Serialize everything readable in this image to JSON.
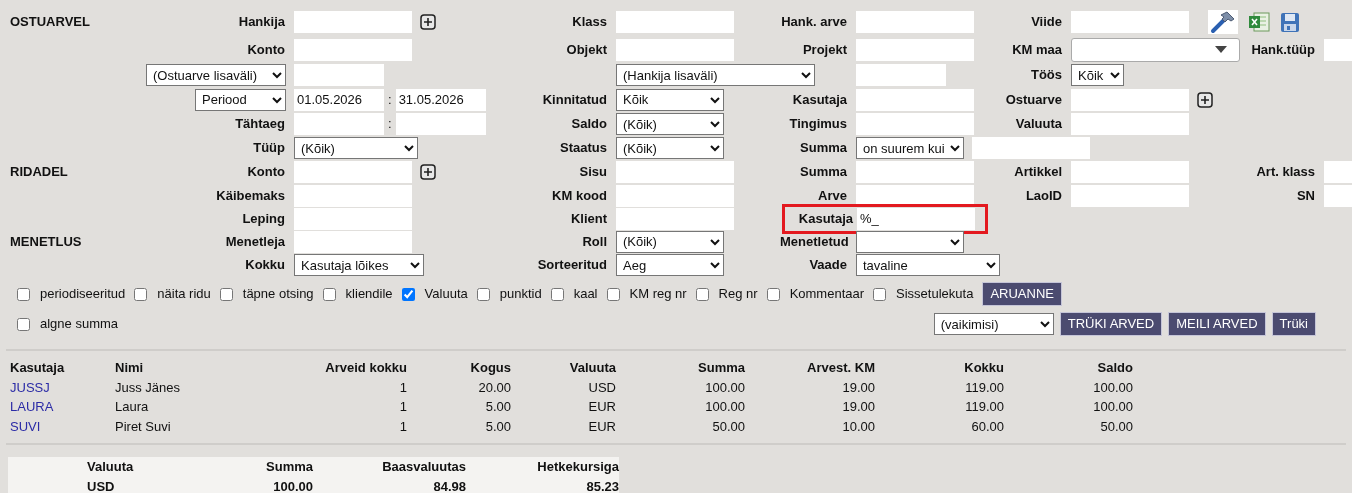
{
  "filter_rows": [
    [
      {
        "kind": "section",
        "text": "OSTUARVEL"
      },
      {
        "kind": "input",
        "label": "Hankija",
        "add_button": true
      },
      {
        "kind": "input",
        "label": "Klass"
      },
      {
        "kind": "input",
        "label": "Hank. arve"
      },
      {
        "kind": "input",
        "label": "Viide"
      }
    ],
    [
      {
        "kind": "input",
        "label": "Konto"
      },
      {
        "kind": "input",
        "label": "Objekt"
      },
      {
        "kind": "input",
        "label": "Projekt"
      },
      {
        "kind": "combo",
        "label": "KM maa"
      },
      {
        "kind": "input",
        "label": "Hank.tüüp"
      }
    ],
    [
      {
        "kind": "input",
        "label_select": "(Ostuarve lisaväli)"
      },
      {
        "kind": "select",
        "value": "(Hankija lisaväli)"
      },
      {
        "kind": "input"
      },
      {
        "kind": "select",
        "label": "Töös",
        "value": "Kõik"
      }
    ],
    [
      {
        "kind": "range",
        "label_select": "Periood",
        "from": "01.05.2026",
        "separator": ":",
        "to": "31.05.2026"
      },
      {
        "kind": "select",
        "label": "Kinnitatud",
        "value": "Kõik"
      },
      {
        "kind": "input",
        "label": "Kasutaja"
      },
      {
        "kind": "input",
        "label": "Ostuarve",
        "add_button": true
      }
    ],
    [
      {
        "kind": "range",
        "label": "Tähtaeg",
        "separator": ":"
      },
      {
        "kind": "select",
        "label": "Saldo",
        "value": "(Kõik)"
      },
      {
        "kind": "input",
        "label": "Tingimus"
      },
      {
        "kind": "input",
        "label": "Valuuta"
      }
    ],
    [
      {
        "kind": "select",
        "label": "Tüüp",
        "value": "(Kõik)"
      },
      {
        "kind": "select",
        "label": "Staatus",
        "value": "(Kõik)"
      },
      {
        "kind": "select-input",
        "label": "Summa",
        "value": "on suurem kui"
      }
    ],
    [
      {
        "kind": "section",
        "text": "RIDADEL"
      },
      {
        "kind": "input",
        "label": "Konto",
        "add_button": true
      },
      {
        "kind": "input",
        "label": "Sisu"
      },
      {
        "kind": "input",
        "label": "Summa"
      },
      {
        "kind": "input",
        "label": "Artikkel"
      },
      {
        "kind": "input",
        "label": "Art. klass"
      }
    ],
    [
      {
        "kind": "input",
        "label": "Käibemaks"
      },
      {
        "kind": "input",
        "label": "KM kood"
      },
      {
        "kind": "input",
        "label": "Arve"
      },
      {
        "kind": "input",
        "label": "LaoID"
      },
      {
        "kind": "input",
        "label": "SN"
      }
    ],
    [
      {
        "kind": "input",
        "label": "Leping"
      },
      {
        "kind": "input",
        "label": "Klient"
      },
      {
        "kind": "input",
        "label": "Kasutaja",
        "value": "%_",
        "highlighted": true
      }
    ],
    [
      {
        "kind": "section",
        "text": "MENETLUS"
      },
      {
        "kind": "input",
        "label": "Menetleja"
      },
      {
        "kind": "select",
        "label": "Roll",
        "value": "(Kõik)"
      },
      {
        "kind": "select",
        "label": "Menetletud"
      }
    ],
    [
      {
        "kind": "select",
        "label": "Kokku",
        "value": "Kasutaja lõikes"
      },
      {
        "kind": "select",
        "label": "Sorteeritud",
        "value": "Aeg"
      },
      {
        "kind": "select",
        "label": "Vaade",
        "value": "tavaline"
      }
    ]
  ],
  "option_rows": [
    [
      {
        "label": "periodiseeritud",
        "checked": false
      },
      {
        "label": "näita ridu",
        "checked": false
      },
      {
        "label": "täpne otsing",
        "checked": false
      },
      {
        "label": "kliendile",
        "checked": false
      },
      {
        "label": "Valuuta",
        "checked": true
      },
      {
        "label": "punktid",
        "checked": false
      },
      {
        "label": "kaal",
        "checked": false
      },
      {
        "label": "KM reg nr",
        "checked": false
      },
      {
        "label": "Reg nr",
        "checked": false
      },
      {
        "label": "Kommentaar",
        "checked": false
      },
      {
        "label": "Sissetulekuta",
        "checked": false
      }
    ],
    [
      {
        "label": "algne summa",
        "checked": false
      }
    ]
  ],
  "report_button": "ARUANNE",
  "print_controls": {
    "select": "(vaikimisi)",
    "buttons": [
      "TRÜKI ARVED",
      "MEILI ARVED",
      "Trüki"
    ]
  },
  "results": {
    "columns": [
      "Kasutaja",
      "Nimi",
      "Arveid kokku",
      "Kogus",
      "Valuuta",
      "Summa",
      "Arvest. KM",
      "Kokku",
      "Saldo"
    ],
    "rows": [
      [
        "JUSSJ",
        "Juss Jänes",
        "1",
        "20.00",
        "USD",
        "100.00",
        "19.00",
        "119.00",
        "100.00"
      ],
      [
        "LAURA",
        "Laura",
        "1",
        "5.00",
        "EUR",
        "100.00",
        "19.00",
        "119.00",
        "100.00"
      ],
      [
        "SUVI",
        "Piret Suvi",
        "1",
        "5.00",
        "EUR",
        "50.00",
        "10.00",
        "60.00",
        "50.00"
      ]
    ]
  },
  "totals": {
    "columns": [
      "Valuuta",
      "Summa",
      "Baasvaluutas",
      "Hetkekursiga"
    ],
    "rows": [
      [
        "USD",
        "100.00",
        "84.98",
        "85.23"
      ]
    ]
  }
}
